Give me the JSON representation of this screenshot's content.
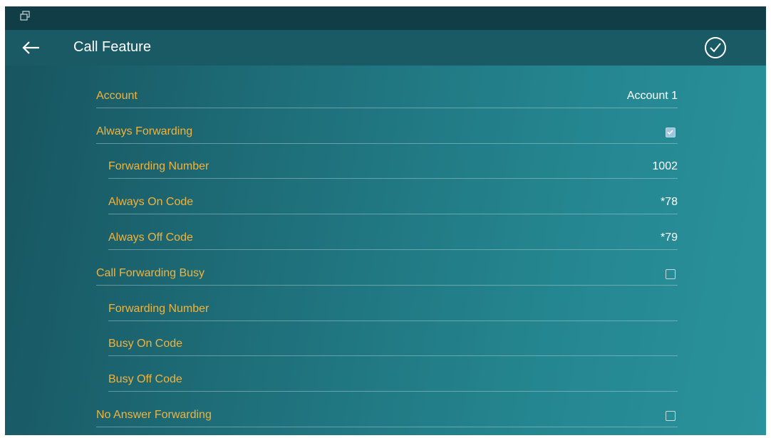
{
  "header": {
    "title": "Call Feature"
  },
  "colors": {
    "label": "#f1b33c",
    "value": "#ffffff",
    "background": "#1e6e79",
    "statusbar": "#113d47"
  },
  "rows": [
    {
      "label": "Account",
      "value": "Account 1"
    },
    {
      "label": "Always Forwarding",
      "checked": true
    },
    {
      "label": "Forwarding Number",
      "value": "1002"
    },
    {
      "label": "Always On Code",
      "value": "*78"
    },
    {
      "label": "Always Off Code",
      "value": "*79"
    },
    {
      "label": "Call Forwarding Busy",
      "checked": false
    },
    {
      "label": "Forwarding Number",
      "value": ""
    },
    {
      "label": "Busy On Code",
      "value": ""
    },
    {
      "label": "Busy Off Code",
      "value": ""
    },
    {
      "label": "No Answer Forwarding",
      "checked": false
    }
  ]
}
